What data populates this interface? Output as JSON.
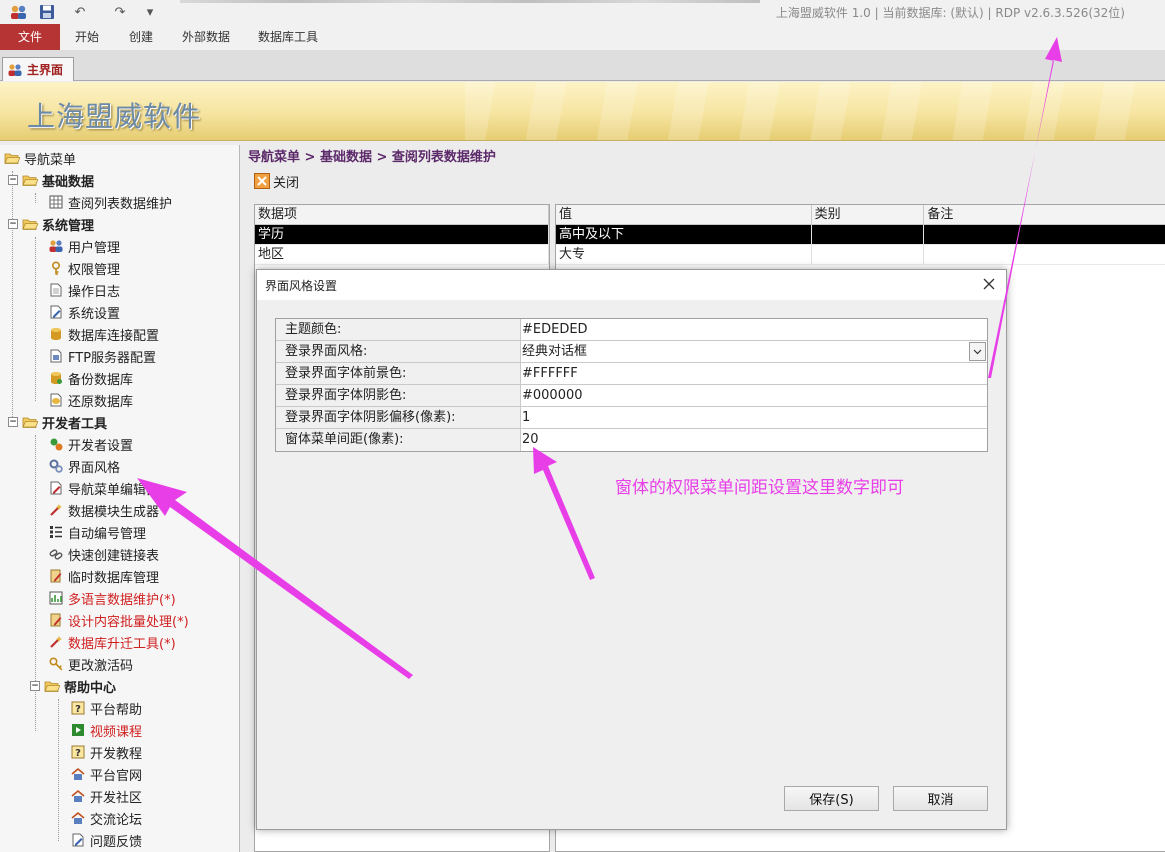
{
  "app": {
    "title_text": "上海盟威软件 1.0 | 当前数据库: (默认) | RDP v2.6.3.526(32位)",
    "quick_access": {
      "undo": "↶",
      "redo": "↷",
      "customize": "▾"
    }
  },
  "ribbon": {
    "tabs": [
      {
        "label": "文件"
      },
      {
        "label": "开始"
      },
      {
        "label": "创建"
      },
      {
        "label": "外部数据"
      },
      {
        "label": "数据库工具"
      }
    ]
  },
  "doc_tab": {
    "label": "主界面"
  },
  "banner": {
    "title": "上海盟威软件"
  },
  "nav": {
    "root": "导航菜单",
    "groups": [
      {
        "label": "基础数据",
        "items": [
          "查阅列表数据维护"
        ]
      },
      {
        "label": "系统管理",
        "items": [
          "用户管理",
          "权限管理",
          "操作日志",
          "系统设置",
          "数据库连接配置",
          "FTP服务器配置",
          "备份数据库",
          "还原数据库"
        ]
      },
      {
        "label": "开发者工具",
        "items": [
          "开发者设置",
          "界面风格",
          "导航菜单编辑器",
          "数据模块生成器",
          "自动编号管理",
          "快速创建链接表",
          "临时数据库管理",
          "多语言数据维护(*)",
          "设计内容批量处理(*)",
          "数据库升迁工具(*)",
          "更改激活码"
        ]
      },
      {
        "label": "帮助中心",
        "items": [
          "平台帮助",
          "视频课程",
          "开发教程",
          "平台官网",
          "开发社区",
          "交流论坛",
          "问题反馈"
        ]
      }
    ]
  },
  "content": {
    "breadcrumb": "导航菜单 > 基础数据 > 查阅列表数据维护",
    "close_label": "关闭",
    "left_grid": {
      "header": "数据项",
      "rows": [
        "学历",
        "地区"
      ]
    },
    "right_grid": {
      "headers": [
        "值",
        "类别",
        "备注"
      ],
      "rows": [
        [
          "高中及以下",
          "",
          ""
        ],
        [
          "大专",
          "",
          ""
        ]
      ]
    }
  },
  "dialog": {
    "title": "界面风格设置",
    "properties": [
      {
        "key": "主题颜色:",
        "value": "#EDEDED"
      },
      {
        "key": "登录界面风格:",
        "value": "经典对话框"
      },
      {
        "key": "登录界面字体前景色:",
        "value": "#FFFFFF"
      },
      {
        "key": "登录界面字体阴影色:",
        "value": "#000000"
      },
      {
        "key": "登录界面字体阴影偏移(像素):",
        "value": "1"
      },
      {
        "key": "窗体菜单间距(像素):",
        "value": "20"
      }
    ],
    "save_label": "保存(S)",
    "cancel_label": "取消"
  },
  "annotation": {
    "text": "窗体的权限菜单间距设置这里数字即可"
  },
  "colors": {
    "file_tab": "#b73434",
    "annotation": "#e83ee8",
    "breadcrumb": "#5c2a6a",
    "red_item": "#d02020"
  }
}
